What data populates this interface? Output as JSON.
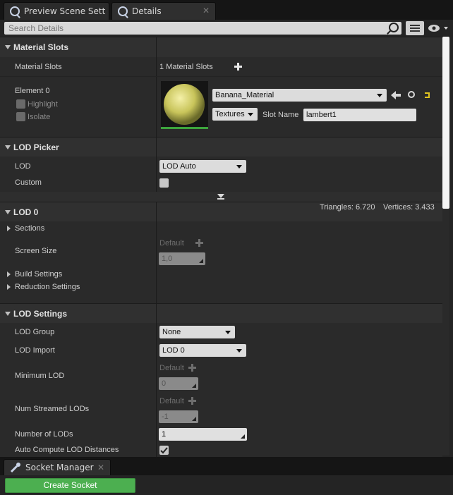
{
  "tabs": [
    {
      "label": "Preview Scene Sett",
      "icon": "details-magnifier-icon"
    },
    {
      "label": "Details",
      "icon": "details-magnifier-icon"
    }
  ],
  "search": {
    "placeholder": "Search Details"
  },
  "material_slots": {
    "header": "Material Slots",
    "row_label": "Material Slots",
    "count_text": "1 Material Slots",
    "element_label": "Element 0",
    "highlight_label": "Highlight",
    "isolate_label": "Isolate",
    "material_name": "Banana_Material",
    "textures_label": "Textures",
    "slot_name_label": "Slot Name",
    "slot_name_value": "lambert1"
  },
  "lod_picker": {
    "header": "LOD Picker",
    "lod_label": "LOD",
    "lod_value": "LOD Auto",
    "custom_label": "Custom"
  },
  "stats": {
    "triangles": "Triangles: 6.720",
    "vertices": "Vertices: 3.433"
  },
  "lod0": {
    "header": "LOD 0",
    "sections_label": "Sections",
    "screen_size_label": "Screen Size",
    "default_label": "Default",
    "screen_size_value": "1,0",
    "build_settings_label": "Build Settings",
    "reduction_settings_label": "Reduction Settings"
  },
  "lod_settings": {
    "header": "LOD Settings",
    "lod_group_label": "LOD Group",
    "lod_group_value": "None",
    "lod_import_label": "LOD Import",
    "lod_import_value": "LOD 0",
    "min_lod_label": "Minimum LOD",
    "default_label": "Default",
    "min_lod_value": "0",
    "num_streamed_label": "Num Streamed LODs",
    "num_streamed_value": "-1",
    "num_lods_label": "Number of LODs",
    "num_lods_value": "1",
    "auto_compute_label": "Auto Compute LOD Distances",
    "auto_compute_checked": true
  },
  "socket_manager": {
    "tab_label": "Socket Manager",
    "create_button": "Create Socket"
  },
  "colors": {
    "create_button": "#4caf50",
    "panel_bg": "#242424"
  }
}
